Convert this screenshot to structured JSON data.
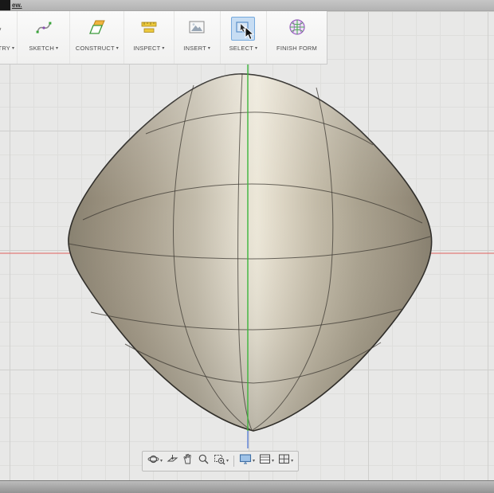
{
  "window": {
    "top_link": "ew."
  },
  "ui": {
    "caret": "▾"
  },
  "toolbar": {
    "groups": [
      {
        "label": "SYMMETRY",
        "caret": true,
        "selected": false
      },
      {
        "label": "SKETCH",
        "caret": true,
        "selected": false
      },
      {
        "label": "CONSTRUCT",
        "caret": true,
        "selected": false
      },
      {
        "label": "INSPECT",
        "caret": true,
        "selected": false
      },
      {
        "label": "INSERT",
        "caret": true,
        "selected": false
      },
      {
        "label": "SELECT",
        "caret": true,
        "selected": true
      },
      {
        "label": "FINISH FORM",
        "caret": false,
        "selected": false
      }
    ]
  },
  "viewport": {
    "model": "t-spline form body",
    "axes": {
      "x_color": "#e0615e",
      "y_color": "#3bb53b",
      "z_color": "#5b7fd6"
    },
    "body_colors": {
      "highlight": "#ece7d8",
      "mid": "#b9b1a0",
      "dark": "#87806f",
      "outline": "#2e2c28"
    }
  },
  "navbar": {
    "buttons": [
      {
        "icon": "orbit-icon",
        "caret": true
      },
      {
        "icon": "look-at-icon",
        "caret": false
      },
      {
        "icon": "pan-hand-icon",
        "caret": false
      },
      {
        "icon": "zoom-icon",
        "caret": false
      },
      {
        "icon": "zoom-window-icon",
        "caret": true
      },
      {
        "icon": "display-settings-icon",
        "caret": true
      },
      {
        "icon": "grid-and-snaps-icon",
        "caret": true
      },
      {
        "icon": "viewports-icon",
        "caret": true
      }
    ]
  }
}
